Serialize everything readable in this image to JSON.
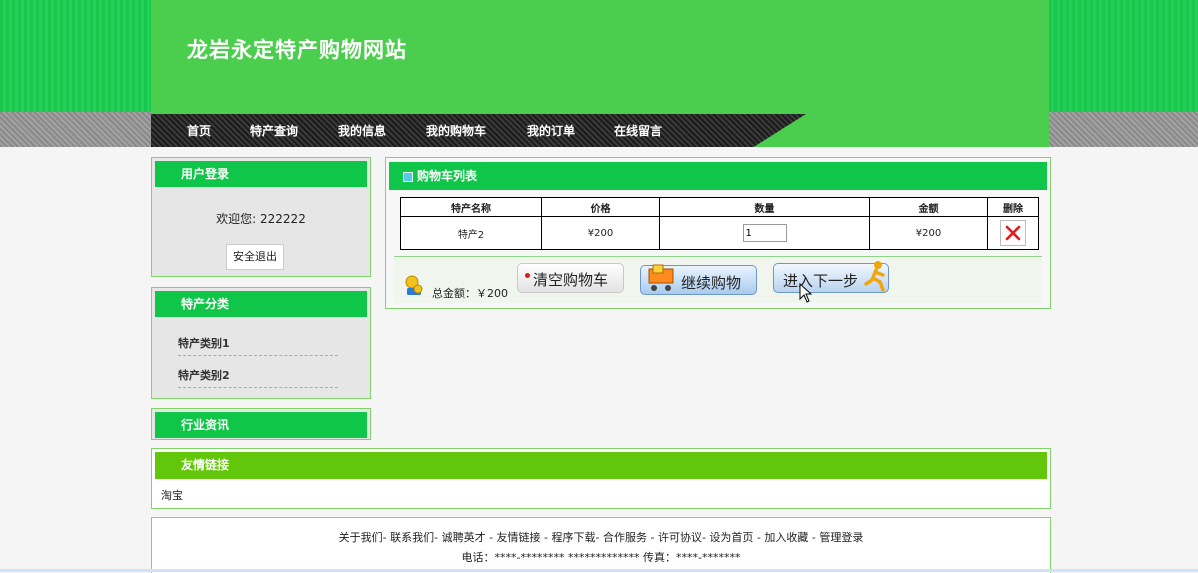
{
  "site": {
    "title": "龙岩永定特产购物网站"
  },
  "nav": {
    "items": [
      "首页",
      "特产查询",
      "我的信息",
      "我的购物车",
      "我的订单",
      "在线留言"
    ]
  },
  "login_box": {
    "title": "用户登录",
    "welcome": "欢迎您: 222222",
    "logout_label": "安全退出"
  },
  "category_box": {
    "title": "特产分类",
    "items": [
      "特产类别1",
      "特产类别2"
    ]
  },
  "news_box": {
    "title": "行业资讯"
  },
  "cart": {
    "title": "购物车列表",
    "columns": [
      "特产名称",
      "价格",
      "数量",
      "金额",
      "删除"
    ],
    "rows": [
      {
        "name": "特产2",
        "price": "¥200",
        "quantity": "1",
        "amount": "¥200"
      }
    ],
    "total_label": "总金额：￥200",
    "buttons": {
      "clear": "清空购物车",
      "continue": "继续购物",
      "next": "进入下一步"
    }
  },
  "links_box": {
    "title": "友情链接",
    "items": [
      "淘宝"
    ]
  },
  "footer": {
    "links_line": "关于我们- 联系我们- 诚聘英才 - 友情链接 - 程序下载- 合作服务 - 许可协议- 设为首页 - 加入收藏 - 管理登录",
    "contact_line": "电话：****-******** ************* 传真：****-*******"
  },
  "colors": {
    "header_green": "#4bce4e",
    "box_head_green": "#10c648",
    "links_head_green": "#62c70a"
  }
}
